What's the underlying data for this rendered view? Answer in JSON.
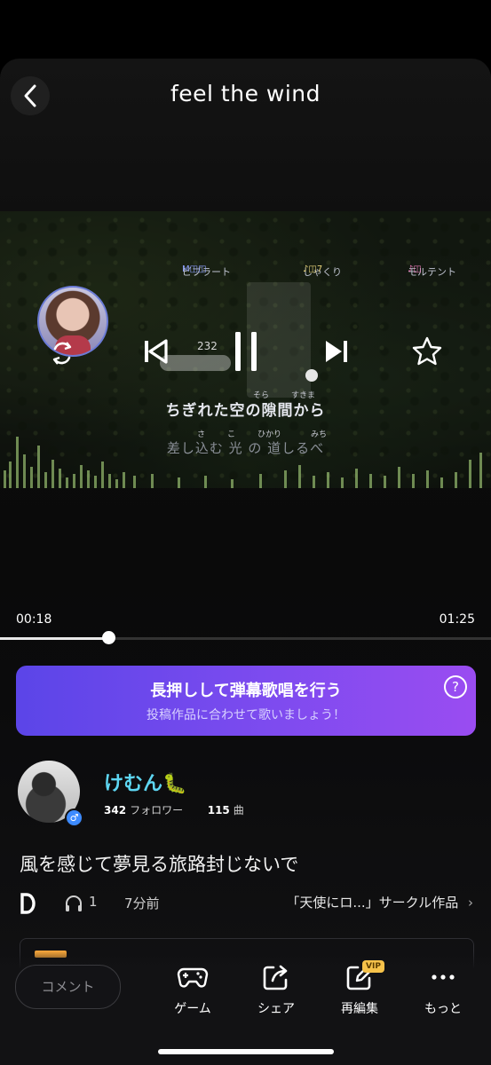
{
  "header": {
    "title": "feel the wind"
  },
  "player": {
    "meters": [
      "ビブラート",
      "しゃくり",
      "モルテント"
    ],
    "counter": "232",
    "lyric_main": "ちぎれた空の隙間から",
    "lyric_ruby": [
      "そら",
      "すきま"
    ],
    "lyric_sub": "差し込む 光 の 道しるべ",
    "lyric_sub_ruby": [
      "さ",
      "こ",
      "ひかり",
      "みち"
    ],
    "current_time": "00:18",
    "total_time": "01:25",
    "progress": 0.22
  },
  "banner": {
    "title": "長押しして弾幕歌唱を行う",
    "subtitle": "投稿作品に合わせて歌いましょう！",
    "help": "?"
  },
  "user": {
    "name": "けむん🐛",
    "followers": "342",
    "followers_label": "フォロワー",
    "songs": "115",
    "songs_label": "曲",
    "gender": "♂"
  },
  "post": {
    "caption": "風を感じて夢見る旅路封じないで",
    "listens": "1",
    "posted": "7分前",
    "circle": "「天使にロ...」サークル作品"
  },
  "bottom": {
    "comment_placeholder": "コメント",
    "actions": [
      {
        "label": "ゲーム",
        "icon": "gamepad-icon"
      },
      {
        "label": "シェア",
        "icon": "share-icon"
      },
      {
        "label": "再編集",
        "icon": "edit-icon",
        "badge": "VIP"
      },
      {
        "label": "もっと",
        "icon": "more-icon"
      }
    ]
  },
  "colors": {
    "accent": "#7d4bef",
    "username": "#5ed6f2",
    "vip": "#f6c24a"
  }
}
